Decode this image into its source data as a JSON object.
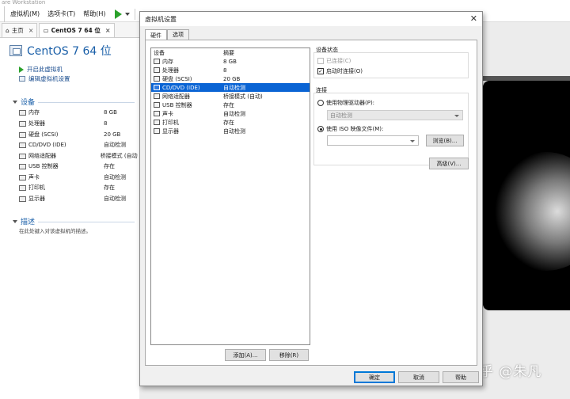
{
  "app": {
    "title_fragment": "are Workstation",
    "menu": [
      "虚拟机(M)",
      "选项卡(T)",
      "帮助(H)"
    ]
  },
  "tabs": [
    {
      "label": "主页",
      "icon": "home-icon"
    },
    {
      "label": "CentOS 7 64 位",
      "icon": "vm-tab-icon"
    }
  ],
  "vm": {
    "name": "CentOS 7 64 位",
    "actions": [
      "开启此虚拟机",
      "编辑虚拟机设置"
    ]
  },
  "devices_section": {
    "title": "设备",
    "items": [
      {
        "name": "内存",
        "summary": "8 GB",
        "icon": "memory-icon"
      },
      {
        "name": "处理器",
        "summary": "8",
        "icon": "cpu-icon"
      },
      {
        "name": "硬盘 (SCSI)",
        "summary": "20 GB",
        "icon": "hdd-icon"
      },
      {
        "name": "CD/DVD (IDE)",
        "summary": "自动检测",
        "icon": "cdrom-icon"
      },
      {
        "name": "网络适配器",
        "summary": "桥接模式 (自动)",
        "icon": "network-icon"
      },
      {
        "name": "USB 控制器",
        "summary": "存在",
        "icon": "usb-icon"
      },
      {
        "name": "声卡",
        "summary": "自动检测",
        "icon": "sound-icon"
      },
      {
        "name": "打印机",
        "summary": "存在",
        "icon": "printer-icon"
      },
      {
        "name": "显示器",
        "summary": "自动检测",
        "icon": "display-icon"
      }
    ]
  },
  "description_section": {
    "title": "描述",
    "text": "在此处键入对该虚拟机的描述。"
  },
  "watermark": "知乎 @朱凡",
  "dialog": {
    "title": "虚拟机设置",
    "close": "✕",
    "tabs": [
      "硬件",
      "选项"
    ],
    "list_headers": {
      "device": "设备",
      "summary": "摘要"
    },
    "selected_index": 3,
    "buttons": {
      "add": "添加(A)...",
      "remove": "移除(R)",
      "advanced": "高级(V)...",
      "browse": "浏览(B)...",
      "ok": "确定",
      "cancel": "取消",
      "help": "帮助"
    },
    "device_status": {
      "title": "设备状态",
      "connected": {
        "label": "已连接(C)",
        "checked": false,
        "enabled": false
      },
      "connect_at_power_on": {
        "label": "启动时连接(O)",
        "checked": true,
        "enabled": true
      }
    },
    "connection": {
      "title": "连接",
      "physical": {
        "label": "使用物理驱动器(P):",
        "selected": false,
        "dropdown_value": "自动检测"
      },
      "iso": {
        "label": "使用 ISO 映像文件(M):",
        "selected": true,
        "value": ""
      }
    }
  }
}
